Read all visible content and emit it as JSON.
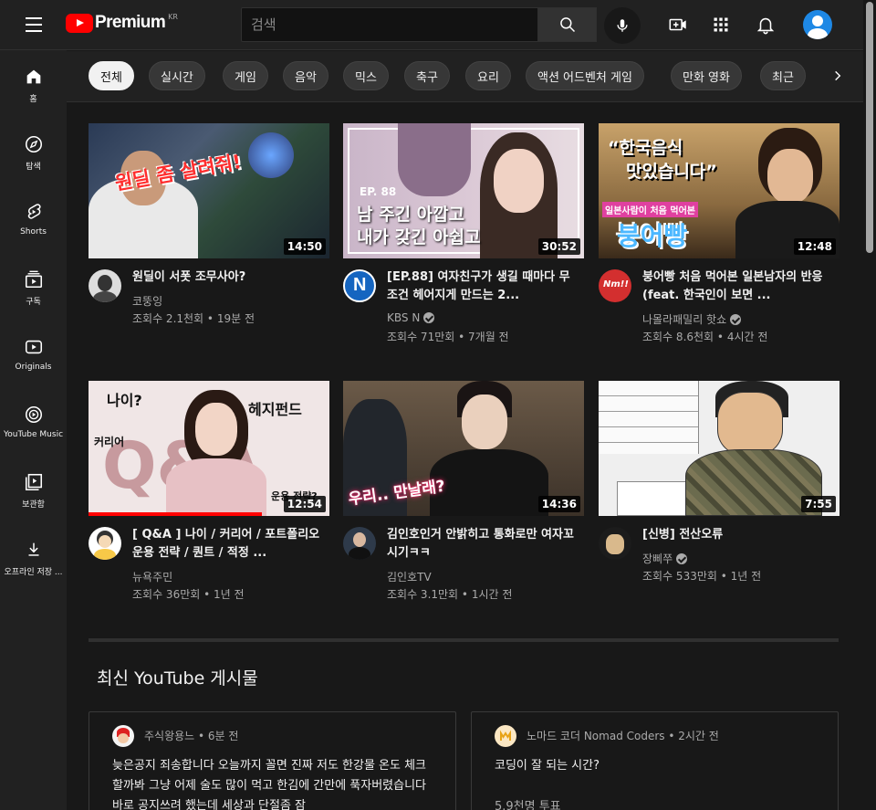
{
  "header": {
    "logo_text": "Premium",
    "region": "KR",
    "search_placeholder": "검색"
  },
  "sidebar": {
    "items": [
      {
        "label": "홈",
        "icon": "home-icon"
      },
      {
        "label": "탐색",
        "icon": "explore-icon"
      },
      {
        "label": "Shorts",
        "icon": "shorts-icon"
      },
      {
        "label": "구독",
        "icon": "subscriptions-icon"
      },
      {
        "label": "Originals",
        "icon": "originals-icon"
      },
      {
        "label": "YouTube Music",
        "icon": "music-icon"
      },
      {
        "label": "보관함",
        "icon": "library-icon"
      },
      {
        "label": "오프라인 저장 ...",
        "icon": "download-icon"
      }
    ]
  },
  "chips": [
    "전체",
    "실시간",
    "게임",
    "음악",
    "믹스",
    "축구",
    "요리",
    "액션 어드벤처 게임",
    "만화 영화",
    "최근"
  ],
  "videos": [
    {
      "title": "원딜이 서폿 조무사아?",
      "channel": "코뚱잉",
      "views": "조회수 2.1천회",
      "age": "19분 전",
      "duration": "14:50",
      "verified": false,
      "thumb_text": [
        "원딜 좀 살려줘!"
      ],
      "progress": 0
    },
    {
      "title": "[EP.88] 여자친구가 생길 때마다 무조건 헤어지게 만드는 2...",
      "channel": "KBS N",
      "views": "조회수 71만회",
      "age": "7개월 전",
      "duration": "30:52",
      "verified": true,
      "thumb_text": [
        "EP. 88",
        "남 주긴 아깝고",
        "내가 갖긴 아쉽고"
      ],
      "progress": 0
    },
    {
      "title": "붕어빵 처음 먹어본 일본남자의 반응 (feat. 한국인이 보면 ...",
      "channel": "나몰라패밀리 핫쇼",
      "views": "조회수 8.6천회",
      "age": "4시간 전",
      "duration": "12:48",
      "verified": true,
      "thumb_text": [
        "“한국음식",
        "맛있습니다”",
        "일본사람이 처음 먹어본",
        "붕어빵"
      ],
      "progress": 0
    },
    {
      "title": "[ Q&A ] 나이 / 커리어 / 포트폴리오 운용 전략 / 퀀트 / 적정 ...",
      "channel": "뉴욕주민",
      "views": "조회수 36만회",
      "age": "1년 전",
      "duration": "12:54",
      "verified": false,
      "thumb_text": [
        "나이?",
        "헤지펀드",
        "커리어",
        "Q&A",
        "운용 전략?"
      ],
      "progress": 0.72
    },
    {
      "title": "김인호인거 안밝히고 통화로만 여자꼬시기ㅋㅋ",
      "channel": "김인호TV",
      "views": "조회수 3.1만회",
      "age": "1시간 전",
      "duration": "14:36",
      "verified": false,
      "thumb_text": [
        "우리.. 만날래?"
      ],
      "progress": 0
    },
    {
      "title": "[신병] 전산오류",
      "channel": "장삐쭈",
      "views": "조회수 533만회",
      "age": "1년 전",
      "duration": "7:55",
      "verified": true,
      "thumb_text": [],
      "progress": 0
    }
  ],
  "posts_section": {
    "title": "최신 YouTube 게시물",
    "posts": [
      {
        "channel": "주식왕용느",
        "age": "6분 전",
        "body": "늦은공지 죄송합니다 오늘까지 꼴면 진짜 저도 한강물 온도 체크할까봐 그냥 어제 술도 많이 먹고 한김에 간만에 푹자버렸습니다 바로 공지쓰려 했는데 세상과 단절좀 잠"
      },
      {
        "channel": "노마드 코더 Nomad Coders",
        "age": "2시간 전",
        "body": "코딩이 잘 되는 시간?",
        "votes": "5.9천명 투표"
      }
    ]
  },
  "colors": {
    "bg": "#181818",
    "bar": "#212121",
    "brand": "#ff0000",
    "text_secondary": "#aaaaaa"
  }
}
